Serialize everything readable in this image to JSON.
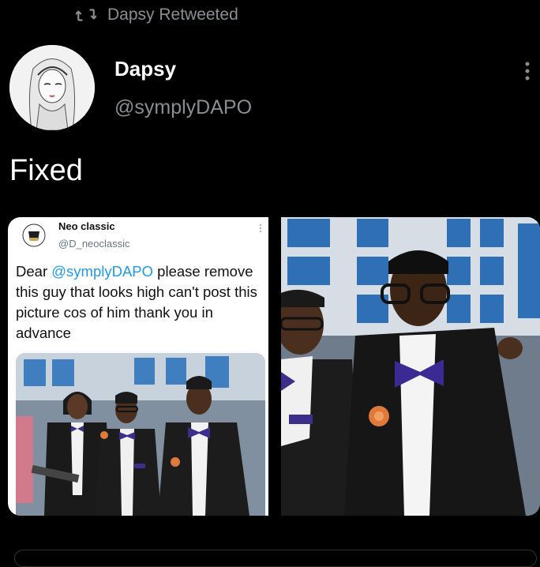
{
  "retweet": {
    "icon": "retweet-icon",
    "label": "Dapsy Retweeted"
  },
  "author": {
    "name": "Dapsy",
    "handle": "@symplyDAPO",
    "avatar_icon": "avatar-sketch-girl"
  },
  "tweet": {
    "text": "Fixed"
  },
  "quoted": {
    "name": "Neo classic",
    "handle": "@D_neoclassic",
    "text_pre": "Dear ",
    "mention": "@symplyDAPO",
    "text_post": " please remove this guy that looks high can't post this picture cos of him thank you in advance"
  },
  "colors": {
    "background": "#000000",
    "secondary_text": "#8a8d91",
    "link": "#1d9bf0"
  }
}
